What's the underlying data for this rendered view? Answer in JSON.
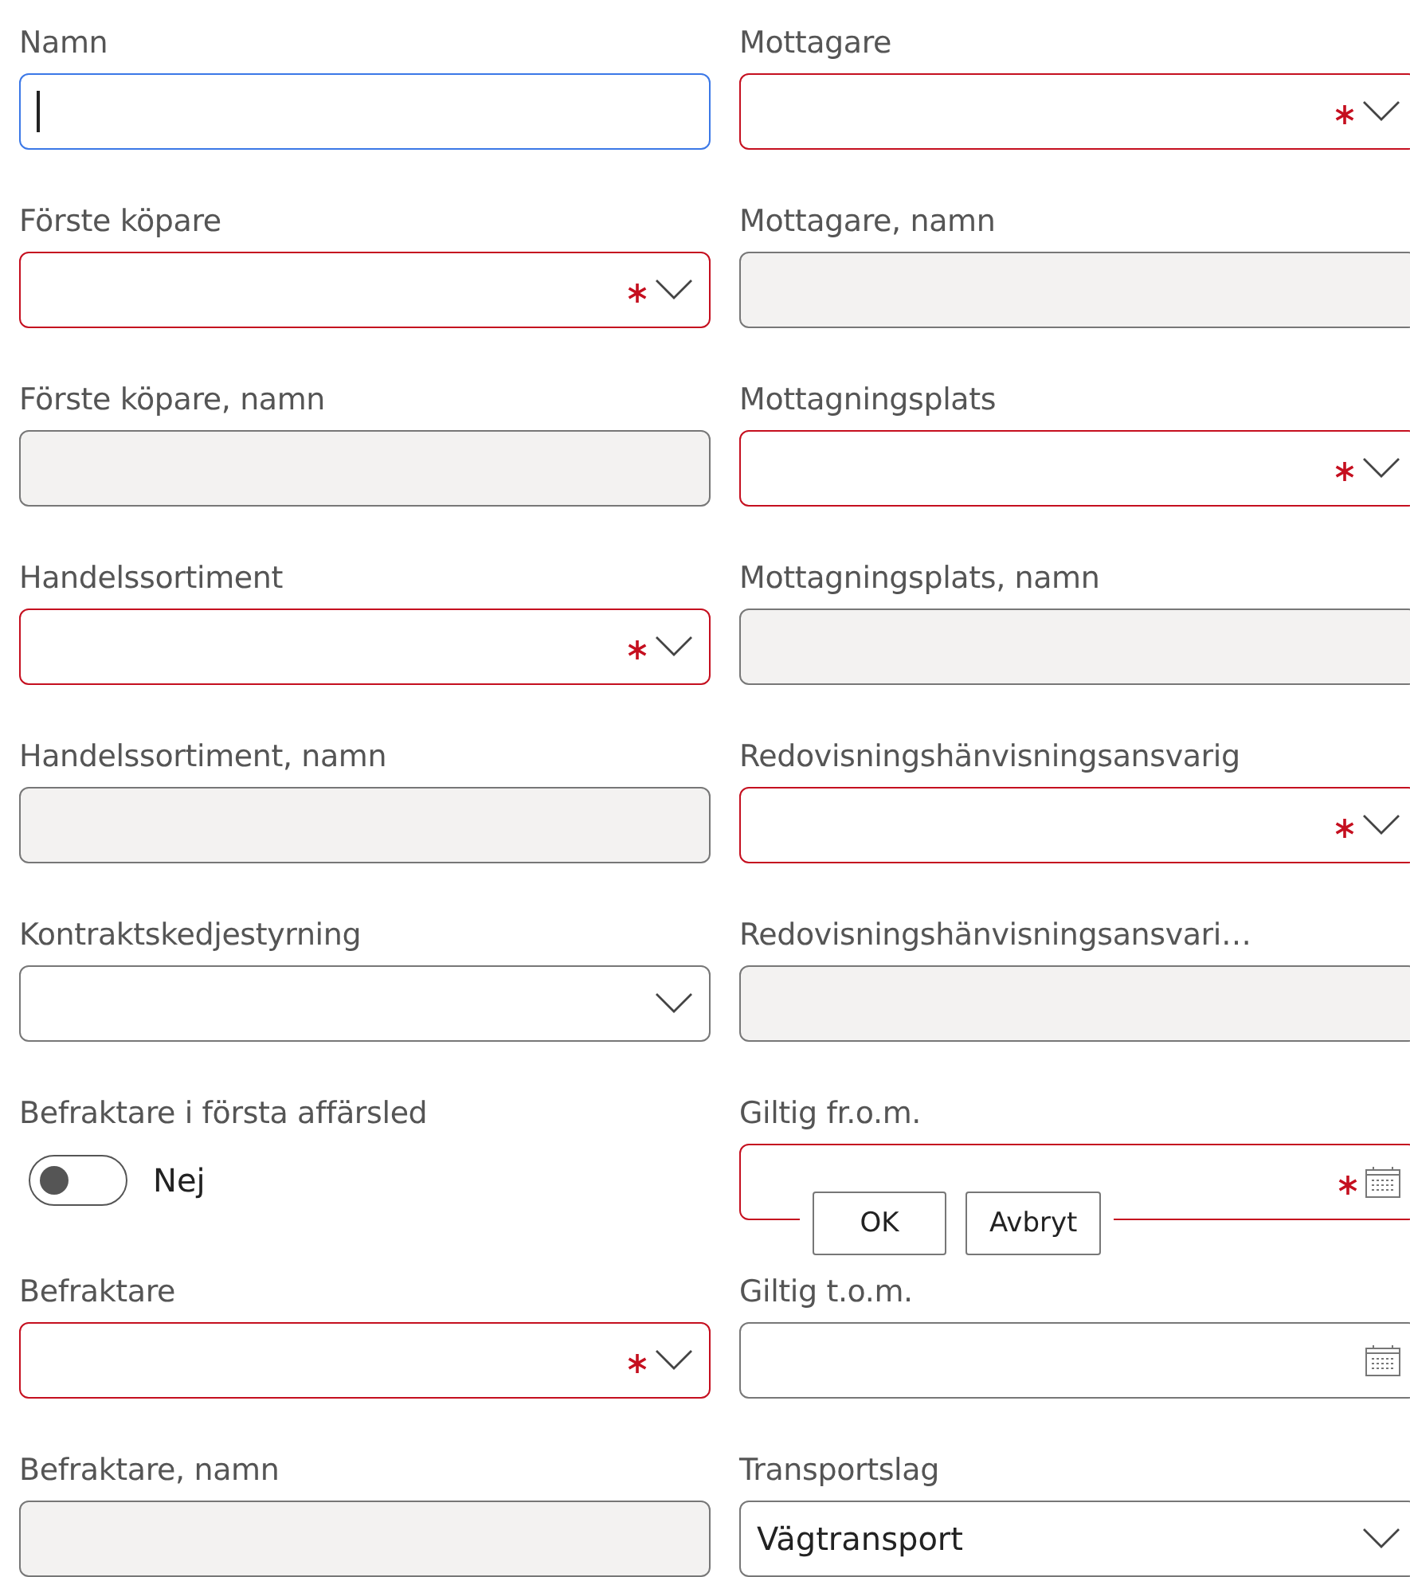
{
  "rows": [
    {
      "left": {
        "kind": "text",
        "label": "Namn",
        "focused": true,
        "required": false
      },
      "right": {
        "kind": "lookup",
        "label": "Mottagare",
        "required": true
      }
    },
    {
      "left": {
        "kind": "lookup",
        "label": "Förste köpare",
        "required": true
      },
      "right": {
        "kind": "readonly",
        "label": "Mottagare, namn"
      }
    },
    {
      "left": {
        "kind": "readonly",
        "label": "Förste köpare, namn"
      },
      "right": {
        "kind": "lookup",
        "label": "Mottagningsplats",
        "required": true
      }
    },
    {
      "left": {
        "kind": "lookup",
        "label": "Handelssortiment",
        "required": true
      },
      "right": {
        "kind": "readonly",
        "label": "Mottagningsplats, namn"
      }
    },
    {
      "left": {
        "kind": "readonly",
        "label": "Handelssortiment, namn"
      },
      "right": {
        "kind": "lookup",
        "label": "Redovisningshänvisningsansvarig",
        "required": true
      }
    },
    {
      "left": {
        "kind": "lookup",
        "label": "Kontraktskedjestyrning",
        "required": false
      },
      "right": {
        "kind": "readonly",
        "label": "Redovisningshänvisningsansvari…"
      }
    },
    {
      "left": {
        "kind": "toggle",
        "label": "Befraktare i första affärsled",
        "on": false,
        "state_text": "Nej"
      },
      "right": {
        "kind": "date",
        "label": "Giltig fr.o.m.",
        "required": true,
        "overlay_buttons": [
          "OK",
          "Avbryt"
        ]
      }
    },
    {
      "left": {
        "kind": "lookup",
        "label": "Befraktare",
        "required": true
      },
      "right": {
        "kind": "date",
        "label": "Giltig t.o.m.",
        "required": false
      }
    },
    {
      "left": {
        "kind": "readonly",
        "label": "Befraktare, namn"
      },
      "right": {
        "kind": "lookup",
        "label": "Transportslag",
        "required": false,
        "value": "Vägtransport"
      }
    }
  ]
}
